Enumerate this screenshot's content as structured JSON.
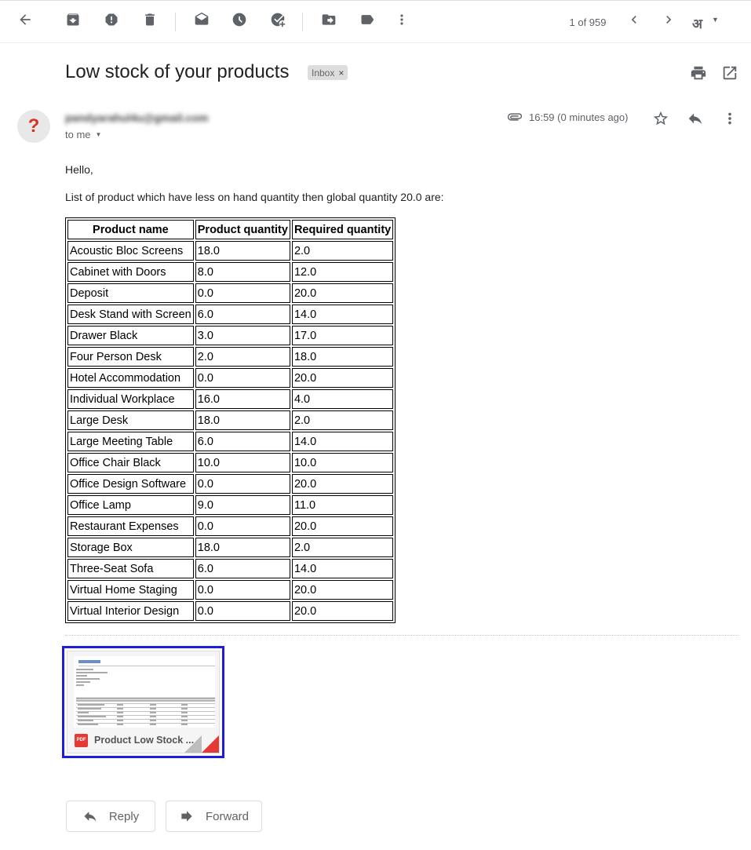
{
  "toolbar": {
    "pager": "1 of 959",
    "lang": "अ"
  },
  "message": {
    "subject": "Low stock of your products",
    "label": "Inbox",
    "label_close": "×",
    "avatar_glyph": "?",
    "sender": "pandyarahul4u@gmail.com",
    "to": "to me",
    "time": "16:59 (0 minutes ago)",
    "greeting": "Hello,",
    "intro": "List of product which have less on hand quantity then global quantity 20.0 are:"
  },
  "table": {
    "headers": [
      "Product name",
      "Product quantity",
      "Required quantity"
    ],
    "rows": [
      [
        "Acoustic Bloc Screens",
        "18.0",
        "2.0"
      ],
      [
        "Cabinet with Doors",
        "8.0",
        "12.0"
      ],
      [
        "Deposit",
        "0.0",
        "20.0"
      ],
      [
        "Desk Stand with Screen",
        "6.0",
        "14.0"
      ],
      [
        "Drawer Black",
        "3.0",
        "17.0"
      ],
      [
        "Four Person Desk",
        "2.0",
        "18.0"
      ],
      [
        "Hotel Accommodation",
        "0.0",
        "20.0"
      ],
      [
        "Individual Workplace",
        "16.0",
        "4.0"
      ],
      [
        "Large Desk",
        "18.0",
        "2.0"
      ],
      [
        "Large Meeting Table",
        "6.0",
        "14.0"
      ],
      [
        "Office Chair Black",
        "10.0",
        "10.0"
      ],
      [
        "Office Design Software",
        "0.0",
        "20.0"
      ],
      [
        "Office Lamp",
        "9.0",
        "11.0"
      ],
      [
        "Restaurant Expenses",
        "0.0",
        "20.0"
      ],
      [
        "Storage Box",
        "18.0",
        "2.0"
      ],
      [
        "Three-Seat Sofa",
        "6.0",
        "14.0"
      ],
      [
        "Virtual Home Staging",
        "0.0",
        "20.0"
      ],
      [
        "Virtual Interior Design",
        "0.0",
        "20.0"
      ]
    ]
  },
  "attachment": {
    "type": "PDF",
    "name": "Product Low Stock ..."
  },
  "actions": {
    "reply": "Reply",
    "forward": "Forward"
  },
  "colors": {
    "attachment_highlight": "#1d1ddb",
    "pdf_red": "#e53935",
    "icon_gray": "#5f6368"
  }
}
